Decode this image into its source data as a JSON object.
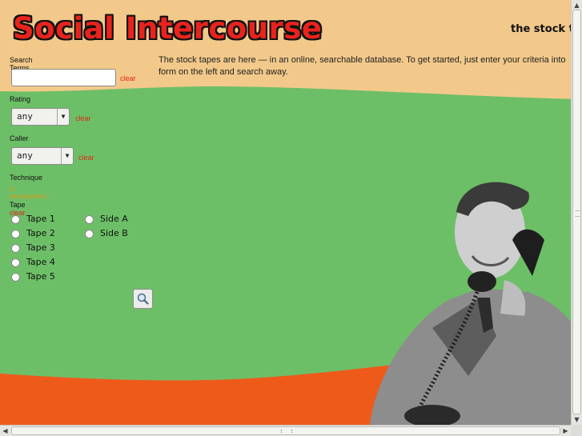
{
  "header": {
    "logo_text": "Social Intercourse",
    "tagline": "the stock ta"
  },
  "intro": {
    "text": "The stock tapes are here — in an online, searchable database. To get started, just enter your criteria into form on the left and search away."
  },
  "form": {
    "search_terms_label": "Search Terms",
    "search_terms_value": "",
    "search_terms_clear": "clear",
    "rating_label": "Rating",
    "rating_value": "any",
    "rating_clear": "clear",
    "caller_label": "Caller",
    "caller_value": "any",
    "caller_clear": "clear",
    "technique_label": "Technique",
    "technique_hint": "in development...",
    "tape_label": "Tape",
    "tape_clear": "clear",
    "tapes": [
      "Tape 1",
      "Tape 2",
      "Tape 3",
      "Tape 4",
      "Tape 5"
    ],
    "sides": [
      "Side A",
      "Side B"
    ],
    "search_button_icon": "magnifier-icon"
  },
  "colors": {
    "background_top": "#f2c98a",
    "background_middle": "#6dbf67",
    "background_bottom": "#ee5a1a",
    "logo": "#e8231d",
    "clear_link": "#e0261a"
  }
}
